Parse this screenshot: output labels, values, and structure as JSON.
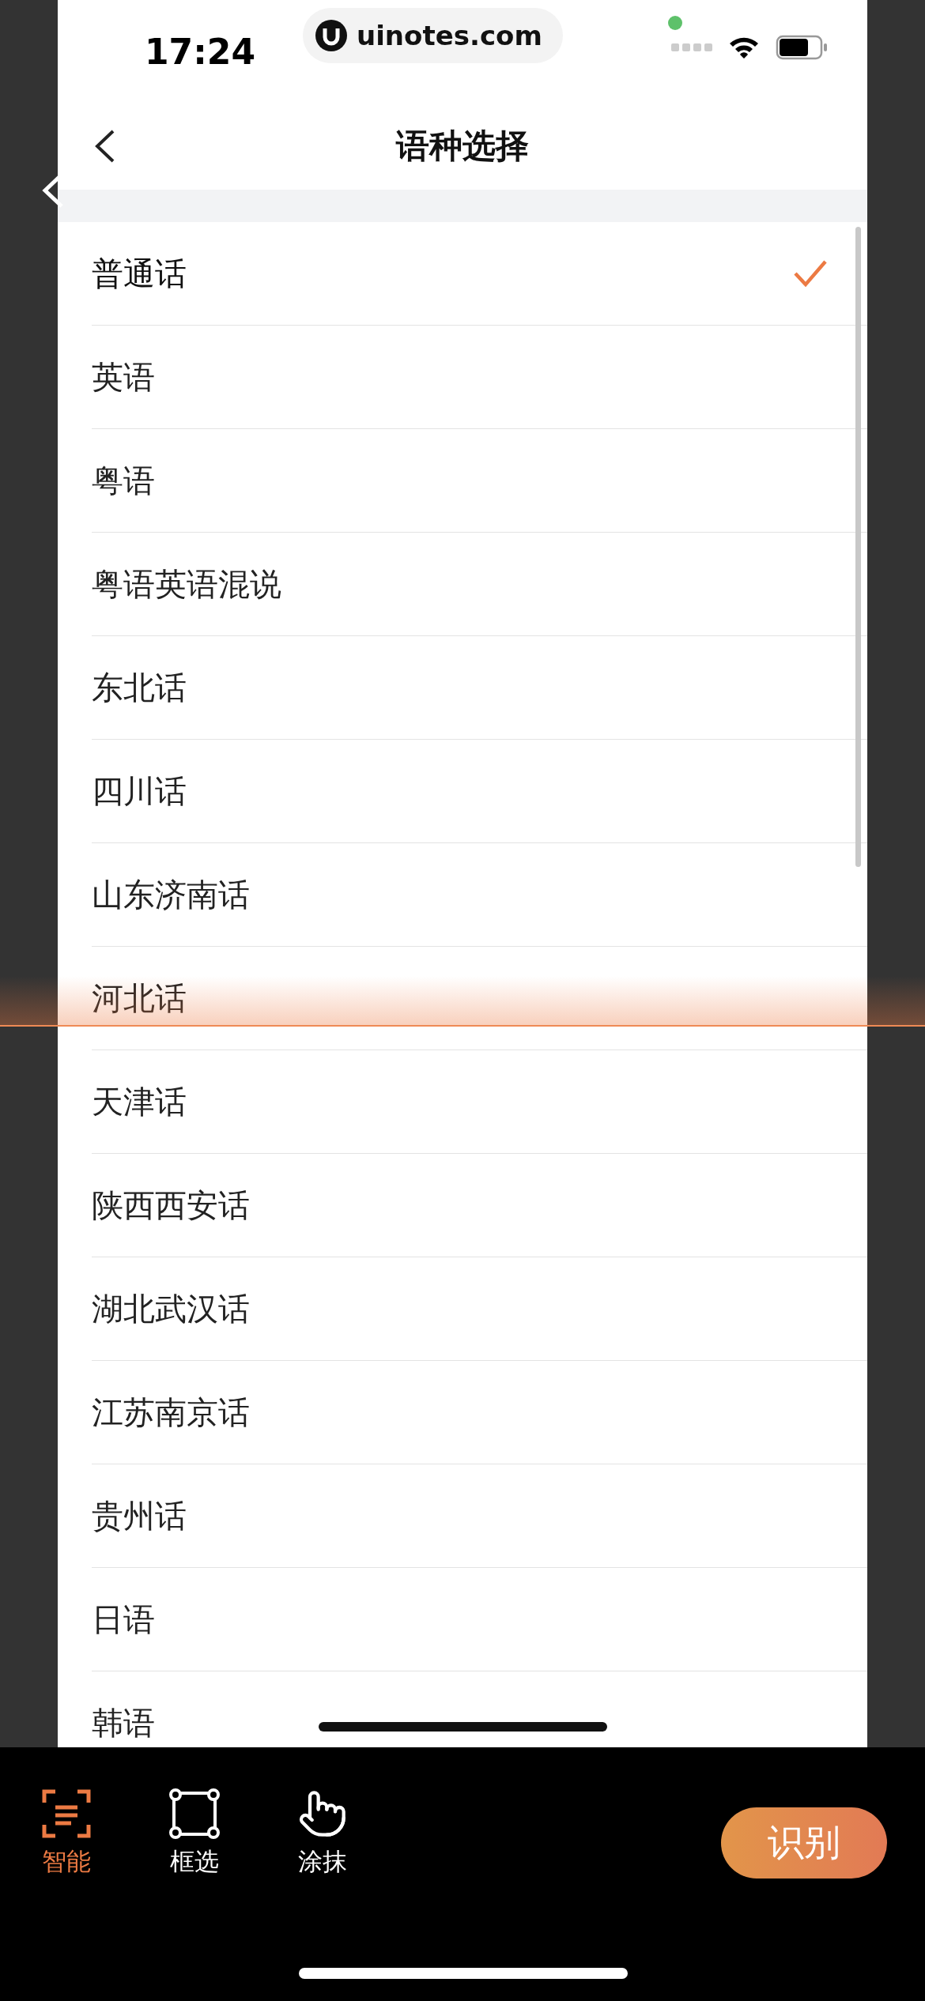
{
  "status_bar": {
    "time": "17:24",
    "url": "uinotes.com"
  },
  "header": {
    "title": "语种选择"
  },
  "languages": [
    {
      "label": "普通话",
      "selected": true
    },
    {
      "label": "英语",
      "selected": false
    },
    {
      "label": "粤语",
      "selected": false
    },
    {
      "label": "粤语英语混说",
      "selected": false
    },
    {
      "label": "东北话",
      "selected": false
    },
    {
      "label": "四川话",
      "selected": false
    },
    {
      "label": "山东济南话",
      "selected": false
    },
    {
      "label": "河北话",
      "selected": false
    },
    {
      "label": "天津话",
      "selected": false
    },
    {
      "label": "陕西西安话",
      "selected": false
    },
    {
      "label": "湖北武汉话",
      "selected": false
    },
    {
      "label": "江苏南京话",
      "selected": false
    },
    {
      "label": "贵州话",
      "selected": false
    },
    {
      "label": "日语",
      "selected": false
    },
    {
      "label": "韩语",
      "selected": false
    }
  ],
  "toolbar": {
    "tools": [
      {
        "kind": "smart",
        "label": "智能",
        "selected": true
      },
      {
        "kind": "frame",
        "label": "框选",
        "selected": false
      },
      {
        "kind": "smear",
        "label": "涂抹",
        "selected": false
      }
    ],
    "action": "识别"
  }
}
